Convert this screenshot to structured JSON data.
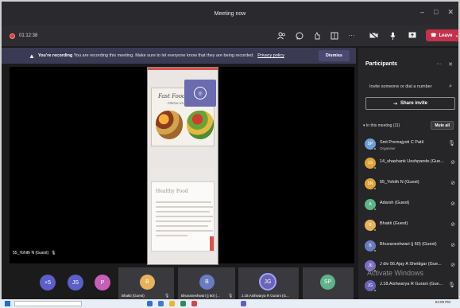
{
  "window": {
    "title": "Meeting now",
    "controls": [
      "minimize-icon",
      "maximize-icon",
      "close-icon"
    ]
  },
  "toolbar": {
    "timer": "01:12:38",
    "leave_label": "Leave",
    "colors": {
      "leave": "#c4314b",
      "record": "#e23b3b"
    }
  },
  "banner": {
    "lead": "You're recording",
    "message": "You are recording this meeting. Make sure to let everyone know that they are being recorded.",
    "link": "Privacy policy",
    "dismiss_label": "Dismiss"
  },
  "shared_content": {
    "food_title": "Fast Food v's",
    "food_subtitle": "FRESH VS. F",
    "healthy_title": "Healthy Food"
  },
  "stage": {
    "speaker_label": "55_Yohith N (Guest)"
  },
  "gallery": {
    "overflow_count": "+5",
    "tiles": [
      {
        "initials": "JS",
        "color": "#5b5fc7"
      },
      {
        "initials": "P",
        "color": "#c65fb5"
      },
      {
        "initials": "B",
        "name": "Bhakti (Guest)",
        "color": "#e8b25a"
      },
      {
        "initials": "B",
        "name": "Bhuvaneshwari (j 60) (...",
        "color": "#6b7bc0"
      },
      {
        "initials": "JG",
        "name": "J.18.Aishwarya R Gurani (G...",
        "color": "#6b63b8"
      },
      {
        "initials": "SP",
        "color": "#5fb38a"
      }
    ]
  },
  "participants": {
    "title": "Participants",
    "invite_placeholder": "Invite someone or dial a number",
    "share_invite_label": "Share invite",
    "in_meeting_label": "In this meeting (11)",
    "mute_all_label": "Mute all",
    "list": [
      {
        "initials": "SP",
        "name": "Smt Premajyoti C Patil",
        "role": "Organiser",
        "color": "#6f9fd8",
        "muted": false
      },
      {
        "initials": "1S",
        "name": "14_shashank Ueshpande (Gue...",
        "color": "#e0a33a",
        "muted": true
      },
      {
        "initials": "5N",
        "name": "55_Yohith N (Guest)",
        "color": "#e0a33a",
        "muted": true
      },
      {
        "initials": "A",
        "name": "Adarsh (Guest)",
        "color": "#5fb38a",
        "muted": true
      },
      {
        "initials": "B",
        "name": "Bhakti (Guest)",
        "color": "#e8b25a",
        "muted": true
      },
      {
        "initials": "B",
        "name": "Bhuvaneshwari (j 60) (Guest)",
        "color": "#6b7bc0",
        "muted": true
      },
      {
        "initials": "J6",
        "name": "J div 56.Ajay A Shettigar (Gue...",
        "color": "#7a6fc0",
        "muted": true
      },
      {
        "initials": "JG",
        "name": "J.18.Aishwarya R Gurani (Gue...",
        "color": "#6b63b8",
        "muted": false
      }
    ]
  },
  "watermark": "Activate Windows",
  "taskbar": {
    "clock": "04:09 PM"
  }
}
